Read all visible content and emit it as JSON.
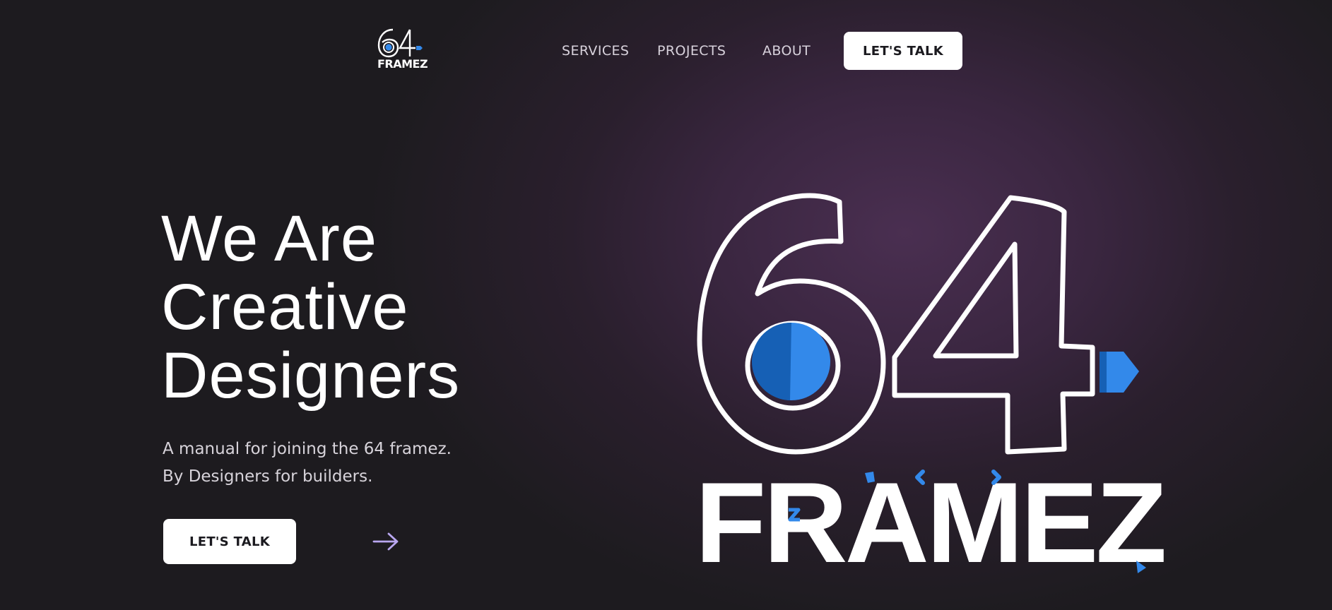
{
  "nav": {
    "logo": {
      "numeral": "64",
      "word": "FRAMEZ"
    },
    "links": [
      "SERVICES",
      "PROJECTS",
      "ABOUT"
    ],
    "cta_label": "LET'S TALK"
  },
  "hero": {
    "title_lines": [
      "We Are",
      "Creative",
      "Designers"
    ],
    "subtitle_lines": [
      "A manual for joining the 64 framez.",
      "By Designers for builders."
    ],
    "cta_label": "LET'S TALK",
    "arrow_icon": "arrow-right-icon"
  },
  "brand_logo": {
    "numeral": "64",
    "word": "FRAMEZ"
  },
  "colors": {
    "background": "#1c1b1e",
    "glow": "#4a2f51",
    "accent_blue": "#3389ea",
    "accent_blue_dark": "#1660b5",
    "arrow": "#b9a7f0",
    "button": "#ffffff"
  }
}
